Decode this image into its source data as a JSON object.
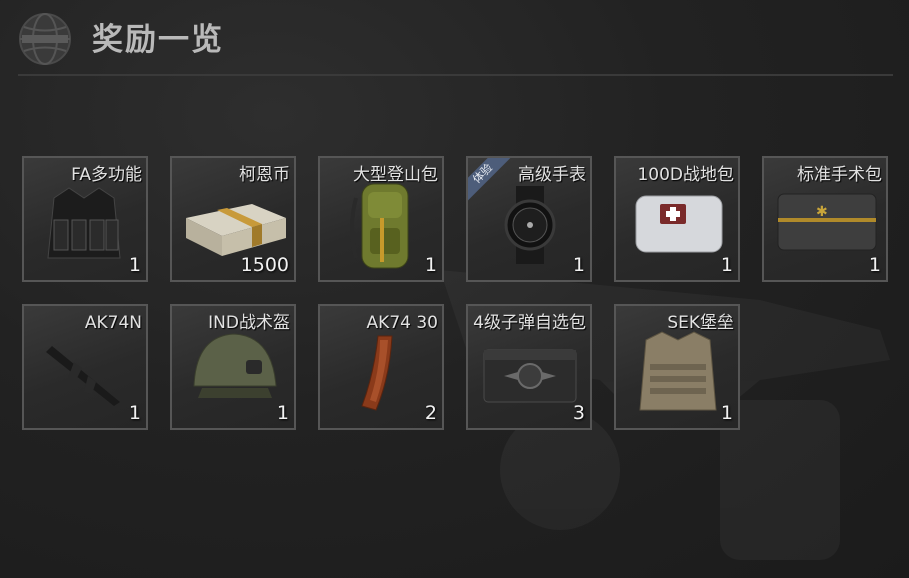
{
  "header": {
    "title": "奖励一览",
    "logo_icon": "globe-emblem-icon"
  },
  "rewards": [
    {
      "name": "FA多功能",
      "count": "1",
      "icon": "tactical-vest-icon"
    },
    {
      "name": "柯恩币",
      "count": "1500",
      "icon": "money-stack-icon"
    },
    {
      "name": "大型登山包",
      "count": "1",
      "icon": "backpack-icon"
    },
    {
      "name": "高级手表",
      "count": "1",
      "icon": "watch-icon",
      "badge": "体验"
    },
    {
      "name": "100D战地包",
      "count": "1",
      "icon": "medkit-bag-icon"
    },
    {
      "name": "标准手术包",
      "count": "1",
      "icon": "surgical-kit-icon"
    },
    {
      "name": "AK74N",
      "count": "1",
      "icon": "rifle-icon"
    },
    {
      "name": "IND战术盔",
      "count": "1",
      "icon": "helmet-icon"
    },
    {
      "name": "AK74 30",
      "count": "2",
      "icon": "magazine-icon"
    },
    {
      "name": "4级子弹自选包",
      "count": "3",
      "icon": "ammo-crate-icon"
    },
    {
      "name": "SEK堡垒",
      "count": "1",
      "icon": "plate-carrier-icon"
    }
  ]
}
